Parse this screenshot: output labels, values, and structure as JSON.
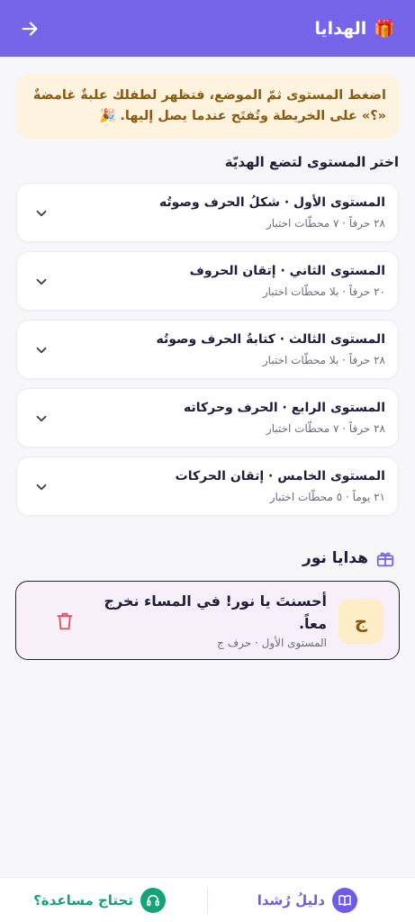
{
  "header": {
    "title": "الهدايا",
    "gift_emoji": "🎁",
    "back_icon": "arrow-back-icon"
  },
  "banner": {
    "text": "اضغط المستوى ثمّ الموضع، فتظهر لطفلك علبةٌ غامضةٌ «؟» على الخريطة وتُفتَح عندما يصل إليها. 🎉"
  },
  "levels_section": {
    "title": "اختر المستوى لتضع الهديّة",
    "levels": [
      {
        "title": "المستوى الأول · شكلُ الحرف وصوتُه",
        "meta": "٢٨ حرفاً · ٧ محطّات اختبار"
      },
      {
        "title": "المستوى الثاني · إتقان الحروف",
        "meta": "٢٠ حرفاً · بلا محطّات اختبار"
      },
      {
        "title": "المستوى الثالث · كتابةُ الحرف وصوتُه",
        "meta": "٢٨ حرفاً · بلا محطّات اختبار"
      },
      {
        "title": "المستوى الرابع · الحرف وحركاته",
        "meta": "٢٨ حرفاً · ٧ محطّات اختبار"
      },
      {
        "title": "المستوى الخامس · إتقان الحركات",
        "meta": "٢١ يوماً · ٥ محطّات اختبار"
      }
    ]
  },
  "gifts_section": {
    "title": "هدايا نور",
    "icon": "gift-box-icon",
    "gift": {
      "letter": "ج",
      "message": "أحسنتَ يا نور! في المساء نخرج معاً.",
      "meta": "المستوى الأول · حرف ج"
    }
  },
  "bottom_bar": {
    "guide_label": "دليلُ رُشدا",
    "help_label": "تحتاج مساعدة؟"
  },
  "colors": {
    "primary": "#7665e8",
    "banner_bg": "#fdf3df",
    "banner_text": "#8a5a12",
    "help_green": "#14a377",
    "delete_red": "#e0505a"
  }
}
